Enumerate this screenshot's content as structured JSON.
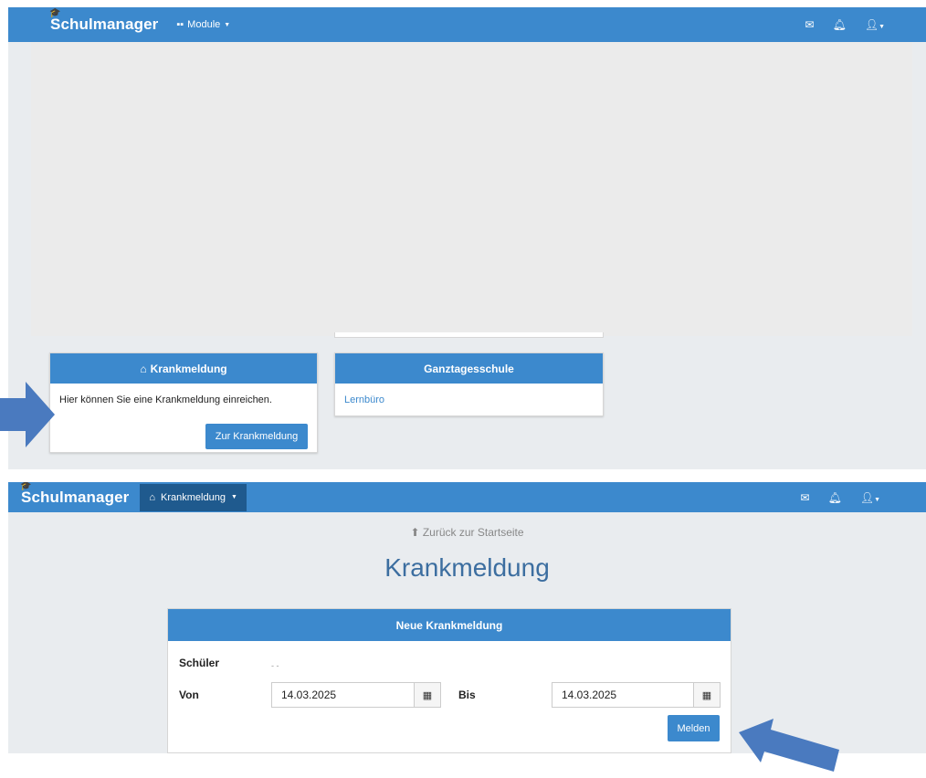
{
  "shot1": {
    "brand": "Schulmanager",
    "module_menu": "Module",
    "card_krank": {
      "title": "Krankmeldung",
      "text": "Hier können Sie eine Krankmeldung einreichen.",
      "button": "Zur Krankmeldung"
    },
    "card_ganztag": {
      "title": "Ganztagesschule",
      "link": "Lernbüro"
    }
  },
  "shot2": {
    "brand": "Schulmanager",
    "active_menu": "Krankmeldung",
    "back_link": "Zurück zur Startseite",
    "page_title": "Krankmeldung",
    "form": {
      "title": "Neue Krankmeldung",
      "student_label": "Schüler",
      "student_value": "- -",
      "from_label": "Von",
      "from_value": "14.03.2025",
      "to_label": "Bis",
      "to_value": "14.03.2025",
      "submit": "Melden"
    }
  },
  "icons": {
    "nav": [
      "mail-icon",
      "bell-icon",
      "user-icon"
    ],
    "accent": "#3c89cd",
    "arrow_color": "#4a7abf"
  }
}
